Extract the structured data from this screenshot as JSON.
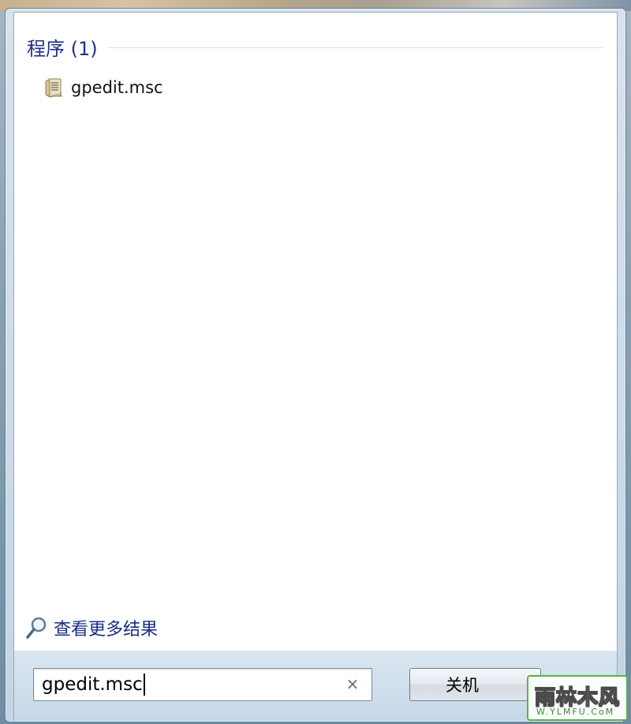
{
  "start_menu": {
    "section_title": "程序 (1)",
    "results": [
      {
        "label": "gpedit.msc",
        "icon": "msc-console-icon"
      }
    ],
    "see_more_label": "查看更多结果",
    "search": {
      "value": "gpedit.msc"
    },
    "shutdown_label": "关机"
  },
  "watermark": {
    "main_text": "雨林木风",
    "sub_text": "W.YLMFU.CoM"
  },
  "colors": {
    "section_title": "#1e3287",
    "link": "#1a2f86",
    "panel_bg": "#ffffff",
    "bottom_bar": "#c6d8e8"
  }
}
